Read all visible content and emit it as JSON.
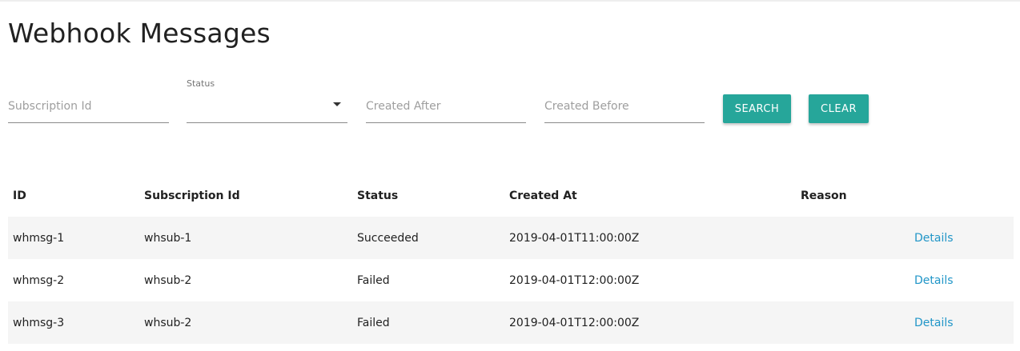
{
  "page": {
    "title": "Webhook Messages"
  },
  "filters": {
    "subscription_id": {
      "placeholder": "Subscription Id",
      "value": ""
    },
    "status": {
      "label": "Status",
      "value": ""
    },
    "created_after": {
      "placeholder": "Created After",
      "value": ""
    },
    "created_before": {
      "placeholder": "Created Before",
      "value": ""
    },
    "search_label": "SEARCH",
    "clear_label": "CLEAR"
  },
  "table": {
    "headers": {
      "id": "ID",
      "subscription_id": "Subscription Id",
      "status": "Status",
      "created_at": "Created At",
      "reason": "Reason"
    },
    "rows": [
      {
        "id": "whmsg-1",
        "subscription_id": "whsub-1",
        "status": "Succeeded",
        "created_at": "2019-04-01T11:00:00Z",
        "reason": "",
        "details": "Details"
      },
      {
        "id": "whmsg-2",
        "subscription_id": "whsub-2",
        "status": "Failed",
        "created_at": "2019-04-01T12:00:00Z",
        "reason": "",
        "details": "Details"
      },
      {
        "id": "whmsg-3",
        "subscription_id": "whsub-2",
        "status": "Failed",
        "created_at": "2019-04-01T12:00:00Z",
        "reason": "",
        "details": "Details"
      }
    ]
  },
  "colors": {
    "accent": "#26a69a",
    "link": "#2196c8",
    "row_shade": "#f5f5f5"
  },
  "icons": {
    "status_dropdown": "caret-down-icon"
  }
}
